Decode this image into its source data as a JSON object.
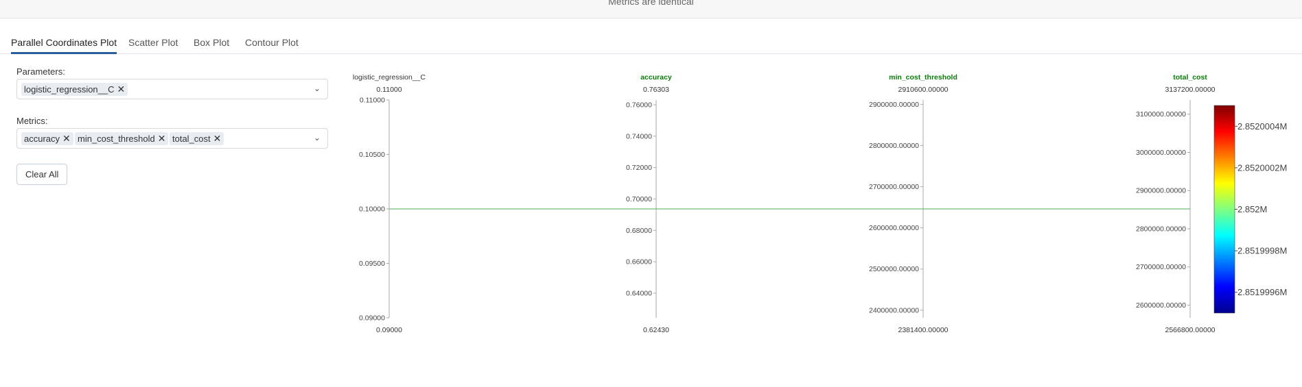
{
  "banner": {
    "text": "Metrics are identical"
  },
  "tabs": [
    {
      "label": "Parallel Coordinates Plot",
      "active": true
    },
    {
      "label": "Scatter Plot",
      "active": false
    },
    {
      "label": "Box Plot",
      "active": false
    },
    {
      "label": "Contour Plot",
      "active": false
    }
  ],
  "parameters": {
    "label": "Parameters:",
    "chips": [
      "logistic_regression__C"
    ]
  },
  "metrics": {
    "label": "Metrics:",
    "chips": [
      "accuracy",
      "min_cost_threshold",
      "total_cost"
    ]
  },
  "clear_button": "Clear All",
  "chart_data": {
    "type": "parallel_coordinates",
    "line_color": "#4caf50",
    "axes": [
      {
        "name": "logistic_regression__C",
        "name_color": "#333333",
        "range": [
          0.09,
          0.11
        ],
        "top_label": "0.11000",
        "bottom_label": "0.09000",
        "ticks": [
          "0.09000",
          "0.09500",
          "0.10000",
          "0.10500",
          "0.11000"
        ]
      },
      {
        "name": "accuracy",
        "name_color": "#0a7a0a",
        "range": [
          0.6243,
          0.76303
        ],
        "top_label": "0.76303",
        "bottom_label": "0.62430",
        "ticks": [
          "0.64000",
          "0.66000",
          "0.68000",
          "0.70000",
          "0.72000",
          "0.74000",
          "0.76000"
        ]
      },
      {
        "name": "min_cost_threshold",
        "name_color": "#0a7a0a",
        "range": [
          2381400,
          2910600
        ],
        "top_label": "2910600.00000",
        "bottom_label": "2381400.00000",
        "ticks": [
          "2400000.00000",
          "2500000.00000",
          "2600000.00000",
          "2700000.00000",
          "2800000.00000",
          "2900000.00000"
        ]
      },
      {
        "name": "total_cost",
        "name_color": "#0a7a0a",
        "range": [
          2566800,
          3137200
        ],
        "top_label": "3137200.00000",
        "bottom_label": "2566800.00000",
        "ticks": [
          "2600000.00000",
          "2700000.00000",
          "2800000.00000",
          "2900000.00000",
          "3000000.00000",
          "3100000.00000"
        ]
      }
    ],
    "lines": [
      {
        "values": [
          0.1,
          0.69366,
          2646000,
          2852000
        ]
      }
    ],
    "colorbar": {
      "colorscale": "jet",
      "range": [
        2851999.5,
        2852000.5
      ],
      "ticks": [
        {
          "value": 2851999.6,
          "label": "2.8519996M"
        },
        {
          "value": 2851999.8,
          "label": "2.8519998M"
        },
        {
          "value": 2852000.0,
          "label": "2.852M"
        },
        {
          "value": 2852000.2,
          "label": "2.8520002M"
        },
        {
          "value": 2852000.4,
          "label": "2.8520004M"
        }
      ]
    }
  }
}
